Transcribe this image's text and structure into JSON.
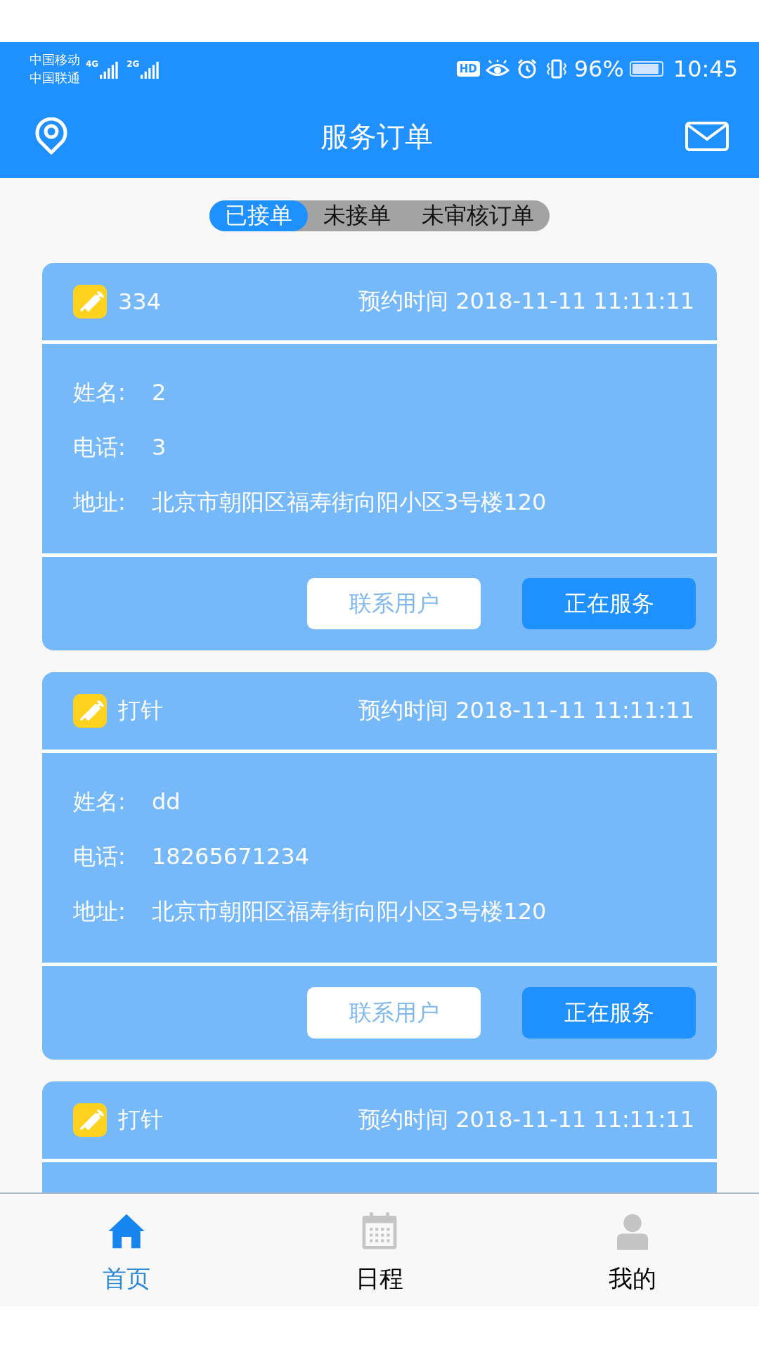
{
  "status_bar": {
    "carriers": [
      "中国移动",
      "中国联通"
    ],
    "networks": [
      "4G",
      "2G"
    ],
    "hd": "HD",
    "battery_text": "96%",
    "time": "10:45"
  },
  "header": {
    "title": "服务订单"
  },
  "tabs": [
    {
      "label": "已接单",
      "selected": true
    },
    {
      "label": "未接单",
      "selected": false
    },
    {
      "label": "未审核订单",
      "selected": false
    }
  ],
  "orders": [
    {
      "title": "334",
      "time": "预约时间 2018-11-11 11:11:11",
      "fields": [
        {
          "label": "姓名:",
          "value": "2"
        },
        {
          "label": "电话:",
          "value": "3"
        },
        {
          "label": "地址:",
          "value": "北京市朝阳区福寿街向阳小区3号楼120"
        }
      ],
      "buttons": [
        {
          "label": "联系用户",
          "kind": "outline"
        },
        {
          "label": "正在服务",
          "kind": "primary"
        }
      ]
    },
    {
      "title": "打针",
      "time": "预约时间 2018-11-11 11:11:11",
      "fields": [
        {
          "label": "姓名:",
          "value": "dd"
        },
        {
          "label": "电话:",
          "value": "18265671234"
        },
        {
          "label": "地址:",
          "value": "北京市朝阳区福寿街向阳小区3号楼120"
        }
      ],
      "buttons": [
        {
          "label": "联系用户",
          "kind": "outline"
        },
        {
          "label": "正在服务",
          "kind": "primary"
        }
      ]
    },
    {
      "title": "打针",
      "time": "预约时间 2018-11-11 11:11:11"
    }
  ],
  "nav": [
    {
      "label": "首页",
      "kind": "home",
      "selected": true
    },
    {
      "label": "日程",
      "kind": "calendar",
      "selected": false
    },
    {
      "label": "我的",
      "kind": "profile",
      "selected": false
    }
  ]
}
